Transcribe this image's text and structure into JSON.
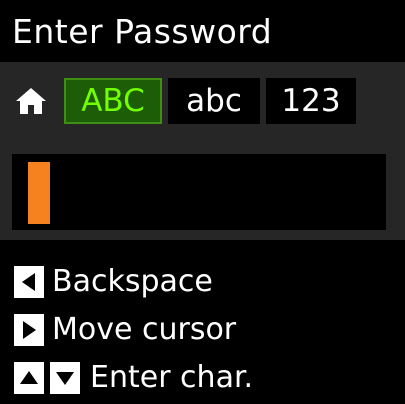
{
  "screen": {
    "title": "Enter Password"
  },
  "mode_bar": {
    "home_icon": "home-icon",
    "tabs": [
      {
        "label": "ABC",
        "active": true
      },
      {
        "label": "abc",
        "active": false
      },
      {
        "label": "123",
        "active": false
      }
    ]
  },
  "input": {
    "value": "",
    "cursor_color": "#f5821f"
  },
  "help": [
    {
      "icons": [
        "left-arrow-icon"
      ],
      "text": "Backspace"
    },
    {
      "icons": [
        "right-arrow-icon"
      ],
      "text": "Move cursor"
    },
    {
      "icons": [
        "up-arrow-icon",
        "down-arrow-icon"
      ],
      "text": "Enter char."
    }
  ],
  "colors": {
    "background": "#000000",
    "bar": "#262626",
    "active_tab_bg": "#1d5d07",
    "active_tab_text": "#72ff00",
    "text": "#ffffff"
  }
}
